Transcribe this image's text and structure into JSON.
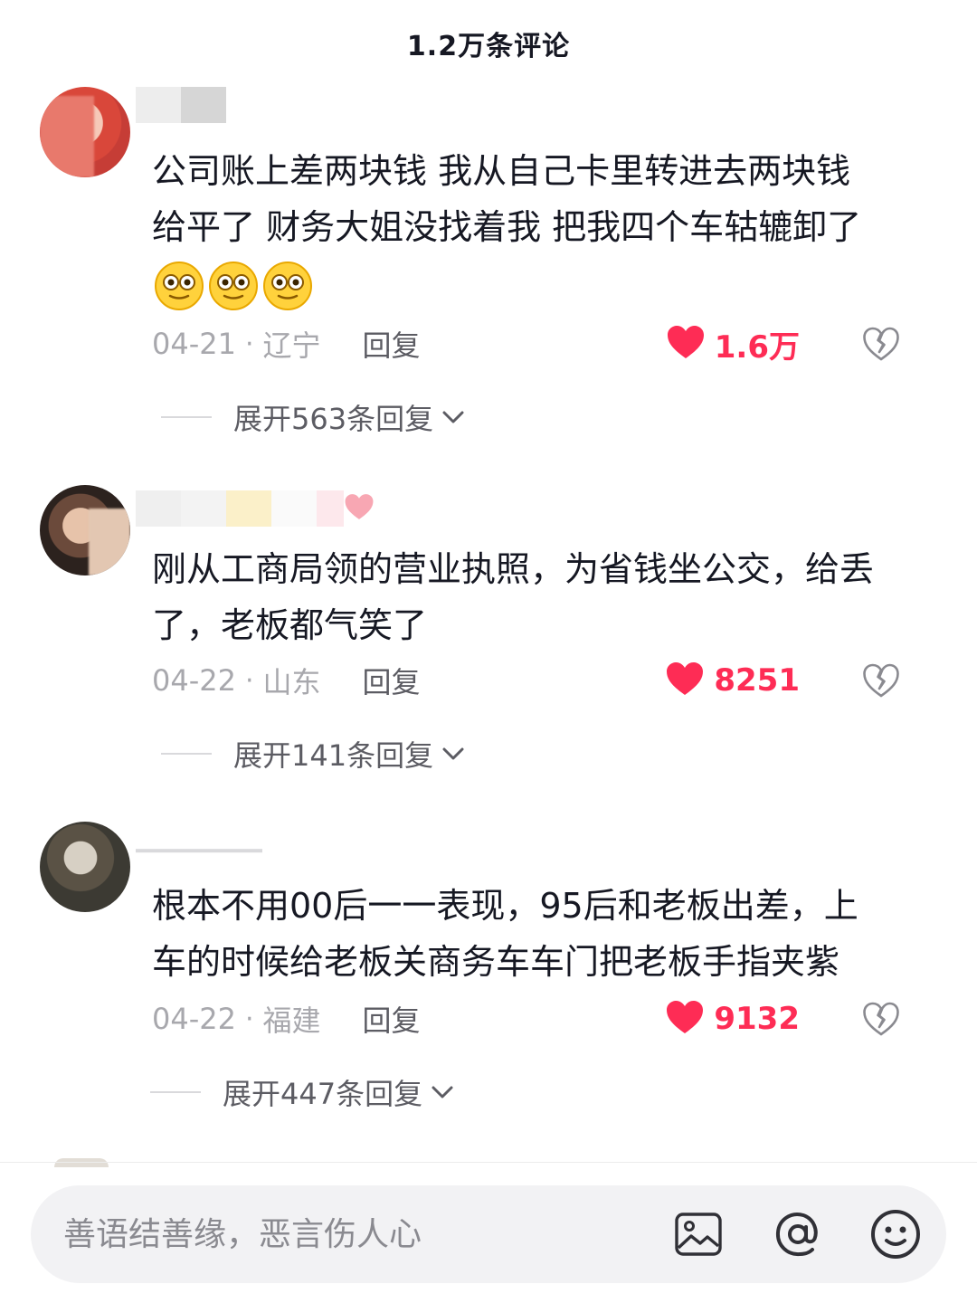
{
  "header": {
    "title": "1.2万条评论"
  },
  "comments": [
    {
      "username": "",
      "text_lines": [
        "公司账上差两块钱  我从自己卡里转进去两块钱",
        "给平了  财务大姐没找着我  把我四个车轱辘卸了"
      ],
      "emojis": [
        "dizzy-face-emoji",
        "dizzy-face-emoji",
        "dizzy-face-emoji"
      ],
      "date": "04-21",
      "location": "辽宁",
      "reply_label": "回复",
      "likes": "1.6万",
      "expand_label": "展开563条回复"
    },
    {
      "username": "",
      "text_lines": [
        "刚从工商局领的营业执照，为省钱坐公交，给丢",
        "了，老板都气笑了"
      ],
      "date": "04-22",
      "location": "山东",
      "reply_label": "回复",
      "likes": "8251",
      "expand_label": "展开141条回复"
    },
    {
      "username": "",
      "text_lines": [
        "根本不用00后一一表现，95后和老板出差，上",
        "车的时候给老板关商务车车门把老板手指夹紫"
      ],
      "date": "04-22",
      "location": "福建",
      "reply_label": "回复",
      "likes": "9132",
      "expand_label": "展开447条回复"
    }
  ],
  "input_bar": {
    "placeholder": "善语结善缘，恶言伤人心",
    "icons": [
      "image-icon",
      "at-icon",
      "emoji-icon"
    ]
  },
  "colors": {
    "accent": "#fe2c55",
    "text": "#161823",
    "muted": "#a8a8ad"
  }
}
